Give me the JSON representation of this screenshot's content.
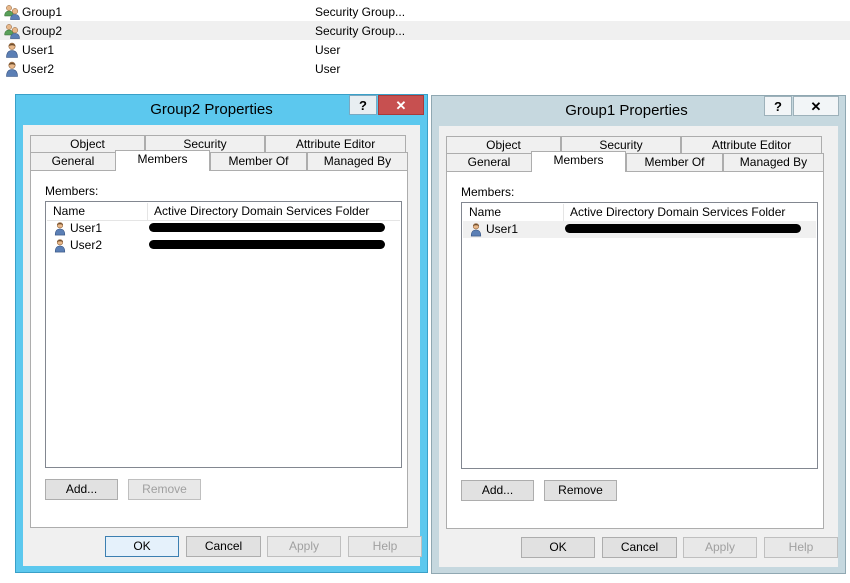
{
  "object_list": [
    {
      "name": "Group1",
      "type": "Security Group...",
      "icon": "group-icon",
      "selected": false
    },
    {
      "name": "Group2",
      "type": "Security Group...",
      "icon": "group-icon",
      "selected": true
    },
    {
      "name": "User1",
      "type": "User",
      "icon": "user-icon",
      "selected": false
    },
    {
      "name": "User2",
      "type": "User",
      "icon": "user-icon",
      "selected": false
    }
  ],
  "dialog_group2": {
    "title": "Group2 Properties",
    "help_glyph": "?",
    "close_glyph": "✕",
    "tabs": {
      "row1": [
        "Object",
        "Security",
        "Attribute Editor"
      ],
      "row2": [
        "General",
        "Members",
        "Member Of",
        "Managed By"
      ],
      "selected": "Members"
    },
    "members_label": "Members:",
    "columns": [
      "Name",
      "Active Directory Domain Services Folder"
    ],
    "members": [
      {
        "name": "User1",
        "icon": "user-icon",
        "folder_redacted": true
      },
      {
        "name": "User2",
        "icon": "user-icon",
        "folder_redacted": true
      }
    ],
    "add_label": "Add...",
    "remove_label": "Remove",
    "remove_enabled": false,
    "ok_label": "OK",
    "cancel_label": "Cancel",
    "apply_label": "Apply",
    "apply_enabled": false,
    "help_label": "Help",
    "help_enabled": false
  },
  "dialog_group1": {
    "title": "Group1 Properties",
    "help_glyph": "?",
    "close_glyph": "✕",
    "tabs": {
      "row1": [
        "Object",
        "Security",
        "Attribute Editor"
      ],
      "row2": [
        "General",
        "Members",
        "Member Of",
        "Managed By"
      ],
      "selected": "Members"
    },
    "members_label": "Members:",
    "columns": [
      "Name",
      "Active Directory Domain Services Folder"
    ],
    "members": [
      {
        "name": "User1",
        "icon": "user-icon",
        "folder_redacted": true
      }
    ],
    "add_label": "Add...",
    "remove_label": "Remove",
    "remove_enabled": true,
    "ok_label": "OK",
    "cancel_label": "Cancel",
    "apply_label": "Apply",
    "apply_enabled": false,
    "help_label": "Help",
    "help_enabled": false
  },
  "colors": {
    "active_frame": "#5cc8ee",
    "inactive_frame": "#c6d8df",
    "close_button_active": "#c75050"
  }
}
